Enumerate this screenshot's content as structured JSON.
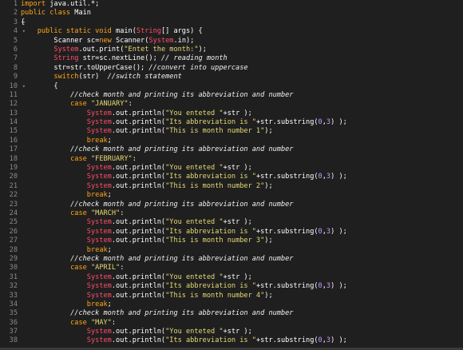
{
  "editor": {
    "lines": [
      {
        "n": "1",
        "fold": "",
        "segs": [
          [
            "kw",
            "import"
          ],
          [
            "plain",
            " java.util.*;"
          ]
        ]
      },
      {
        "n": "2",
        "fold": "",
        "segs": [
          [
            "kw",
            "public class"
          ],
          [
            "plain",
            " Main"
          ]
        ]
      },
      {
        "n": "3",
        "fold": "▾",
        "segs": [
          [
            "plain",
            "{"
          ]
        ]
      },
      {
        "n": "4",
        "fold": "▾",
        "segs": [
          [
            "plain",
            "    "
          ],
          [
            "kw",
            "public static void"
          ],
          [
            "plain",
            " main("
          ],
          [
            "type",
            "String"
          ],
          [
            "plain",
            "[] args) {"
          ]
        ]
      },
      {
        "n": "5",
        "fold": "",
        "segs": [
          [
            "plain",
            "        Scanner sc="
          ],
          [
            "kw",
            "new"
          ],
          [
            "plain",
            " Scanner("
          ],
          [
            "type",
            "System"
          ],
          [
            "plain",
            ".in);"
          ]
        ]
      },
      {
        "n": "6",
        "fold": "",
        "segs": [
          [
            "plain",
            "        "
          ],
          [
            "type",
            "System"
          ],
          [
            "plain",
            ".out.print("
          ],
          [
            "str",
            "\"Entet the month:\""
          ],
          [
            "plain",
            ");"
          ]
        ]
      },
      {
        "n": "7",
        "fold": "",
        "segs": [
          [
            "plain",
            "        "
          ],
          [
            "type",
            "String"
          ],
          [
            "plain",
            " str=sc.nextLine(); "
          ],
          [
            "com",
            "// reading month"
          ]
        ]
      },
      {
        "n": "8",
        "fold": "",
        "segs": [
          [
            "plain",
            "        str=str.toUpperCase(); "
          ],
          [
            "com",
            "//convert into uppercase"
          ]
        ]
      },
      {
        "n": "9",
        "fold": "",
        "segs": [
          [
            "plain",
            "        "
          ],
          [
            "kw",
            "switch"
          ],
          [
            "plain",
            "(str)  "
          ],
          [
            "com",
            "//switch statement"
          ]
        ]
      },
      {
        "n": "10",
        "fold": "▾",
        "segs": [
          [
            "plain",
            "        {"
          ]
        ]
      },
      {
        "n": "11",
        "fold": "",
        "segs": [
          [
            "plain",
            "            "
          ],
          [
            "com",
            "//check month and printing its abbreviation and number"
          ]
        ]
      },
      {
        "n": "12",
        "fold": "",
        "segs": [
          [
            "plain",
            "            "
          ],
          [
            "kw",
            "case"
          ],
          [
            "plain",
            " "
          ],
          [
            "str",
            "\"JANUARY\""
          ],
          [
            "plain",
            ":"
          ]
        ]
      },
      {
        "n": "13",
        "fold": "",
        "segs": [
          [
            "plain",
            "                "
          ],
          [
            "type",
            "System"
          ],
          [
            "plain",
            ".out.println("
          ],
          [
            "str",
            "\"You enteted \""
          ],
          [
            "plain",
            "+str );"
          ]
        ]
      },
      {
        "n": "14",
        "fold": "",
        "segs": [
          [
            "plain",
            "                "
          ],
          [
            "type",
            "System"
          ],
          [
            "plain",
            ".out.println("
          ],
          [
            "str",
            "\"Its abbreviation is \""
          ],
          [
            "plain",
            "+str.substring("
          ],
          [
            "num-lit",
            "0"
          ],
          [
            "plain",
            ","
          ],
          [
            "num-lit",
            "3"
          ],
          [
            "plain",
            ") );"
          ]
        ]
      },
      {
        "n": "15",
        "fold": "",
        "segs": [
          [
            "plain",
            "                "
          ],
          [
            "type",
            "System"
          ],
          [
            "plain",
            ".out.println("
          ],
          [
            "str",
            "\"This is month number 1\""
          ],
          [
            "plain",
            ");"
          ]
        ]
      },
      {
        "n": "16",
        "fold": "",
        "segs": [
          [
            "plain",
            "                "
          ],
          [
            "kw",
            "break"
          ],
          [
            "plain",
            ";"
          ]
        ]
      },
      {
        "n": "17",
        "fold": "",
        "segs": [
          [
            "plain",
            "            "
          ],
          [
            "com",
            "//check month and printing its abbreviation and number"
          ]
        ]
      },
      {
        "n": "18",
        "fold": "",
        "segs": [
          [
            "plain",
            "            "
          ],
          [
            "kw",
            "case"
          ],
          [
            "plain",
            " "
          ],
          [
            "str",
            "\"FEBRUARY\""
          ],
          [
            "plain",
            ":"
          ]
        ]
      },
      {
        "n": "19",
        "fold": "",
        "segs": [
          [
            "plain",
            "                "
          ],
          [
            "type",
            "System"
          ],
          [
            "plain",
            ".out.println("
          ],
          [
            "str",
            "\"You enteted \""
          ],
          [
            "plain",
            "+str );"
          ]
        ]
      },
      {
        "n": "20",
        "fold": "",
        "segs": [
          [
            "plain",
            "                "
          ],
          [
            "type",
            "System"
          ],
          [
            "plain",
            ".out.println("
          ],
          [
            "str",
            "\"Its abbreviation is \""
          ],
          [
            "plain",
            "+str.substring("
          ],
          [
            "num-lit",
            "0"
          ],
          [
            "plain",
            ","
          ],
          [
            "num-lit",
            "3"
          ],
          [
            "plain",
            ") );"
          ]
        ]
      },
      {
        "n": "21",
        "fold": "",
        "segs": [
          [
            "plain",
            "                "
          ],
          [
            "type",
            "System"
          ],
          [
            "plain",
            ".out.println("
          ],
          [
            "str",
            "\"This is month number 2\""
          ],
          [
            "plain",
            ");"
          ]
        ]
      },
      {
        "n": "22",
        "fold": "",
        "segs": [
          [
            "plain",
            "                "
          ],
          [
            "kw",
            "break"
          ],
          [
            "plain",
            ";"
          ]
        ]
      },
      {
        "n": "23",
        "fold": "",
        "segs": [
          [
            "plain",
            "            "
          ],
          [
            "com",
            "//check month and printing its abbreviation and number"
          ]
        ]
      },
      {
        "n": "24",
        "fold": "",
        "segs": [
          [
            "plain",
            "            "
          ],
          [
            "kw",
            "case"
          ],
          [
            "plain",
            " "
          ],
          [
            "str",
            "\"MARCH\""
          ],
          [
            "plain",
            ":"
          ]
        ]
      },
      {
        "n": "25",
        "fold": "",
        "segs": [
          [
            "plain",
            "                "
          ],
          [
            "type",
            "System"
          ],
          [
            "plain",
            ".out.println("
          ],
          [
            "str",
            "\"You enteted \""
          ],
          [
            "plain",
            "+str );"
          ]
        ]
      },
      {
        "n": "26",
        "fold": "",
        "segs": [
          [
            "plain",
            "                "
          ],
          [
            "type",
            "System"
          ],
          [
            "plain",
            ".out.println("
          ],
          [
            "str",
            "\"Its abbreviation is \""
          ],
          [
            "plain",
            "+str.substring("
          ],
          [
            "num-lit",
            "0"
          ],
          [
            "plain",
            ","
          ],
          [
            "num-lit",
            "3"
          ],
          [
            "plain",
            ") );"
          ]
        ]
      },
      {
        "n": "27",
        "fold": "",
        "segs": [
          [
            "plain",
            "                "
          ],
          [
            "type",
            "System"
          ],
          [
            "plain",
            ".out.println("
          ],
          [
            "str",
            "\"This is month number 3\""
          ],
          [
            "plain",
            ");"
          ]
        ]
      },
      {
        "n": "28",
        "fold": "",
        "segs": [
          [
            "plain",
            "                "
          ],
          [
            "kw",
            "break"
          ],
          [
            "plain",
            ";"
          ]
        ]
      },
      {
        "n": "29",
        "fold": "",
        "segs": [
          [
            "plain",
            "            "
          ],
          [
            "com",
            "//check month and printing its abbreviation and number"
          ]
        ]
      },
      {
        "n": "30",
        "fold": "",
        "segs": [
          [
            "plain",
            "            "
          ],
          [
            "kw",
            "case"
          ],
          [
            "plain",
            " "
          ],
          [
            "str",
            "\"APRIL\""
          ],
          [
            "plain",
            ":"
          ]
        ]
      },
      {
        "n": "31",
        "fold": "",
        "segs": [
          [
            "plain",
            "                "
          ],
          [
            "type",
            "System"
          ],
          [
            "plain",
            ".out.println("
          ],
          [
            "str",
            "\"You enteted \""
          ],
          [
            "plain",
            "+str );"
          ]
        ]
      },
      {
        "n": "32",
        "fold": "",
        "segs": [
          [
            "plain",
            "                "
          ],
          [
            "type",
            "System"
          ],
          [
            "plain",
            ".out.println("
          ],
          [
            "str",
            "\"Its abbreviation is \""
          ],
          [
            "plain",
            "+str.substring("
          ],
          [
            "num-lit",
            "0"
          ],
          [
            "plain",
            ","
          ],
          [
            "num-lit",
            "3"
          ],
          [
            "plain",
            ") );"
          ]
        ]
      },
      {
        "n": "33",
        "fold": "",
        "segs": [
          [
            "plain",
            "                "
          ],
          [
            "type",
            "System"
          ],
          [
            "plain",
            ".out.println("
          ],
          [
            "str",
            "\"This is month number 4\""
          ],
          [
            "plain",
            ");"
          ]
        ]
      },
      {
        "n": "34",
        "fold": "",
        "segs": [
          [
            "plain",
            "                "
          ],
          [
            "kw",
            "break"
          ],
          [
            "plain",
            ";"
          ]
        ]
      },
      {
        "n": "35",
        "fold": "",
        "segs": [
          [
            "plain",
            "            "
          ],
          [
            "com",
            "//check month and printing its abbreviation and number"
          ]
        ]
      },
      {
        "n": "36",
        "fold": "",
        "segs": [
          [
            "plain",
            "            "
          ],
          [
            "kw",
            "case"
          ],
          [
            "plain",
            " "
          ],
          [
            "str",
            "\"MAY\""
          ],
          [
            "plain",
            ":"
          ]
        ]
      },
      {
        "n": "37",
        "fold": "",
        "segs": [
          [
            "plain",
            "                "
          ],
          [
            "type",
            "System"
          ],
          [
            "plain",
            ".out.println("
          ],
          [
            "str",
            "\"You enteted \""
          ],
          [
            "plain",
            "+str );"
          ]
        ]
      },
      {
        "n": "38",
        "fold": "",
        "segs": [
          [
            "plain",
            "                "
          ],
          [
            "type",
            "System"
          ],
          [
            "plain",
            ".out.println("
          ],
          [
            "str",
            "\"Its abbreviation is \""
          ],
          [
            "plain",
            "+str.substring("
          ],
          [
            "num-lit",
            "0"
          ],
          [
            "plain",
            ","
          ],
          [
            "num-lit",
            "3"
          ],
          [
            "plain",
            ") );"
          ]
        ]
      }
    ]
  },
  "colors": {
    "background": "#1f1f1f",
    "keyword": "#ffa61a",
    "type": "#ff4d6a",
    "string": "#e6db74",
    "comment": "#f2f2f2",
    "number": "#c59cff",
    "gutter": "#8a8a8a"
  }
}
